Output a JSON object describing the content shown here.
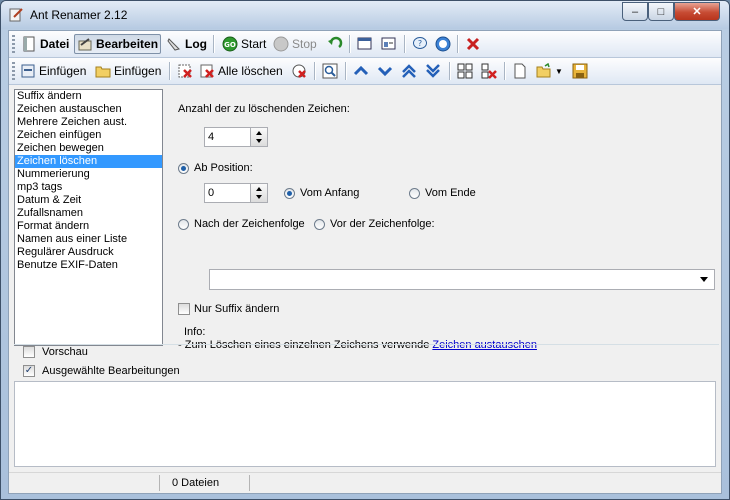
{
  "window": {
    "title": "Ant Renamer 2.12",
    "controls": {
      "minimize": "–",
      "maximize": "□",
      "close": "✕"
    }
  },
  "toolbar1": {
    "datei": "Datei",
    "bearbeiten": "Bearbeiten",
    "log": "Log",
    "start": "Start",
    "stop": "Stop"
  },
  "toolbar2": {
    "einfuegen1": "Einfügen",
    "einfuegen2": "Einfügen",
    "alle_loeschen": "Alle löschen"
  },
  "actions": {
    "items": [
      "Suffix ändern",
      "Zeichen austauschen",
      "Mehrere Zeichen aust.",
      "Zeichen einfügen",
      "Zeichen bewegen",
      "Zeichen löschen",
      "Nummerierung",
      "mp3 tags",
      "Datum & Zeit",
      "Zufallsnamen",
      "Format ändern",
      "Namen aus einer Liste",
      "Regulärer Ausdruck",
      "Benutze EXIF-Daten"
    ],
    "selected": "Zeichen löschen"
  },
  "panel": {
    "count_label": "Anzahl der zu löschenden Zeichen:",
    "count_value": "4",
    "ab_position_label": "Ab Position:",
    "position_value": "0",
    "vom_anfang": "Vom Anfang",
    "vom_ende": "Vom Ende",
    "nach_label": "Nach der Zeichenfolge",
    "vor_label": "Vor der Zeichenfolge:",
    "sequence_value": "",
    "nur_suffix": "Nur Suffix ändern",
    "info_title": "Info:",
    "info_text": "- Zum Löschen eines einzelnen Zeichens verwende",
    "info_link": "Zeichen austauschen"
  },
  "bottom": {
    "vorschau": "Vorschau",
    "ausgewaehlte": "Ausgewählte Bearbeitungen",
    "ausgewaehlte_checked": "✓"
  },
  "status": {
    "files": "0 Dateien"
  },
  "colors": {
    "selection": "#3399ff",
    "link": "#0000cc",
    "accent": "#1f5fa8"
  }
}
